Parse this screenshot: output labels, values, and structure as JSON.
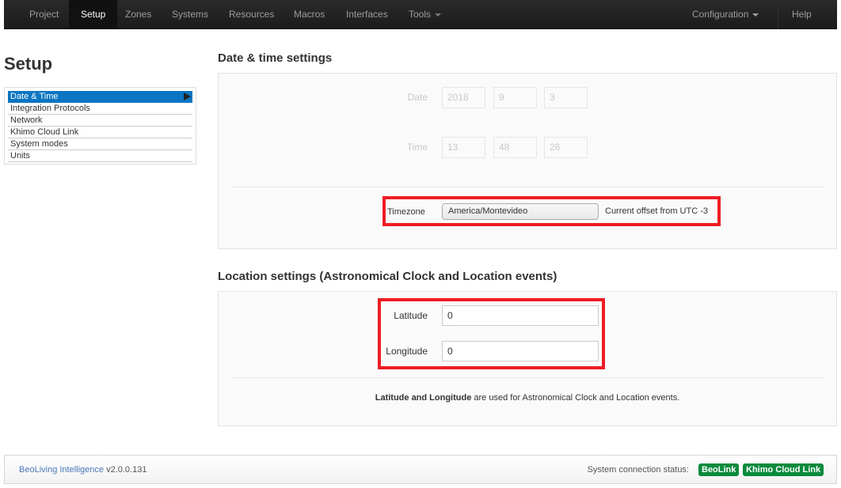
{
  "navbar": {
    "items": [
      {
        "label": "Project"
      },
      {
        "label": "Setup",
        "active": true
      },
      {
        "label": "Zones"
      },
      {
        "label": "Systems"
      },
      {
        "label": "Resources"
      },
      {
        "label": "Macros"
      },
      {
        "label": "Interfaces"
      },
      {
        "label": "Tools",
        "dropdown": true
      }
    ],
    "right_items": [
      {
        "label": "Configuration",
        "dropdown": true
      },
      {
        "label": "Help"
      }
    ]
  },
  "sidebar": {
    "title": "Setup",
    "items": [
      {
        "label": "Date & Time",
        "active": true
      },
      {
        "label": "Integration Protocols"
      },
      {
        "label": "Network"
      },
      {
        "label": "Khimo Cloud Link"
      },
      {
        "label": "System modes"
      },
      {
        "label": "Units"
      }
    ]
  },
  "datetime": {
    "title": "Date & time settings",
    "date_label": "Date",
    "date": {
      "year": "2018",
      "month": "9",
      "day": "3"
    },
    "time_label": "Time",
    "time": {
      "hour": "13",
      "minute": "48",
      "second": "26"
    },
    "timezone_label": "Timezone",
    "timezone_value": "America/Montevideo",
    "offset_text": "Current offset from UTC -3"
  },
  "location": {
    "title": "Location settings (Astronomical Clock and Location events)",
    "latitude_label": "Latitude",
    "latitude_value": "0",
    "longitude_label": "Longitude",
    "longitude_value": "0",
    "help_bold": "Latitude and Longitude",
    "help_rest": " are used for Astronomical Clock and Location events."
  },
  "footer": {
    "brand": "BeoLiving Intelligence",
    "version": " v2.0.0.131",
    "status_label": "System connection status:",
    "badges": [
      "BeoLink",
      "Khimo Cloud Link"
    ],
    "badge_color": "#0a8a3c"
  },
  "colors": {
    "highlight_box": "#ee1c24",
    "active_menu": "#0a75c2"
  }
}
